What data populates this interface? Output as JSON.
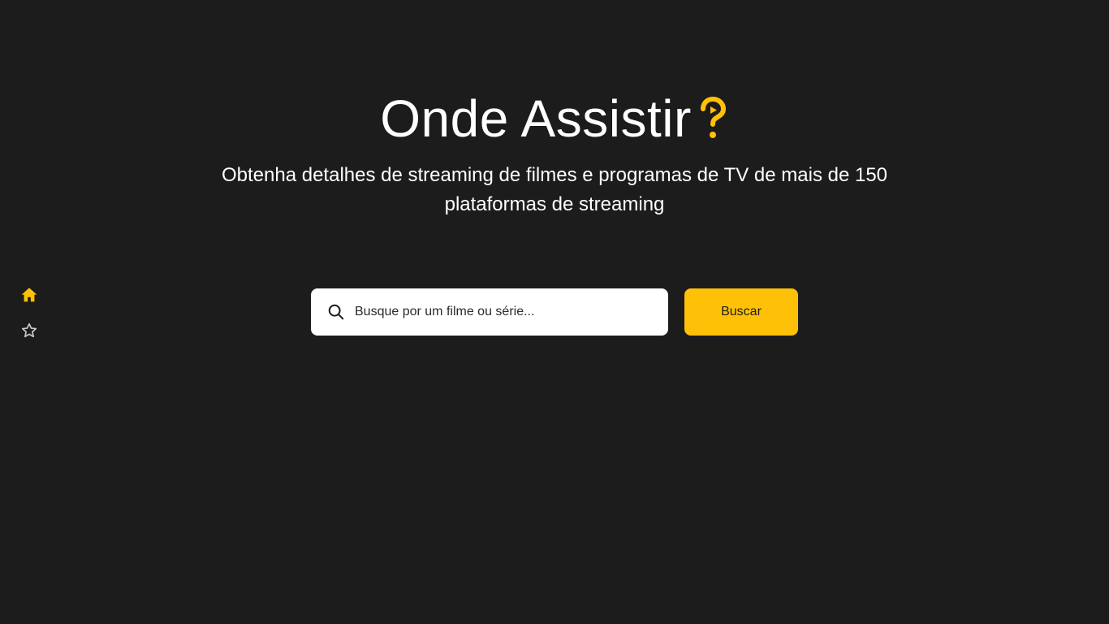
{
  "sidebar": {
    "items": [
      {
        "icon": "home-icon",
        "active": true
      },
      {
        "icon": "star-icon",
        "active": false
      }
    ]
  },
  "hero": {
    "title": "Onde Assistir",
    "title_icon": "question-mark-play-icon",
    "subtitle": "Obtenha detalhes de streaming de filmes e programas de TV de mais de 150 plataformas de streaming"
  },
  "search": {
    "placeholder": "Busque por um filme ou série...",
    "value": "",
    "button_label": "Buscar"
  },
  "colors": {
    "background": "#1c1c1c",
    "accent": "#ffc107",
    "text": "#ffffff",
    "icon_inactive": "#cfcfcf"
  }
}
